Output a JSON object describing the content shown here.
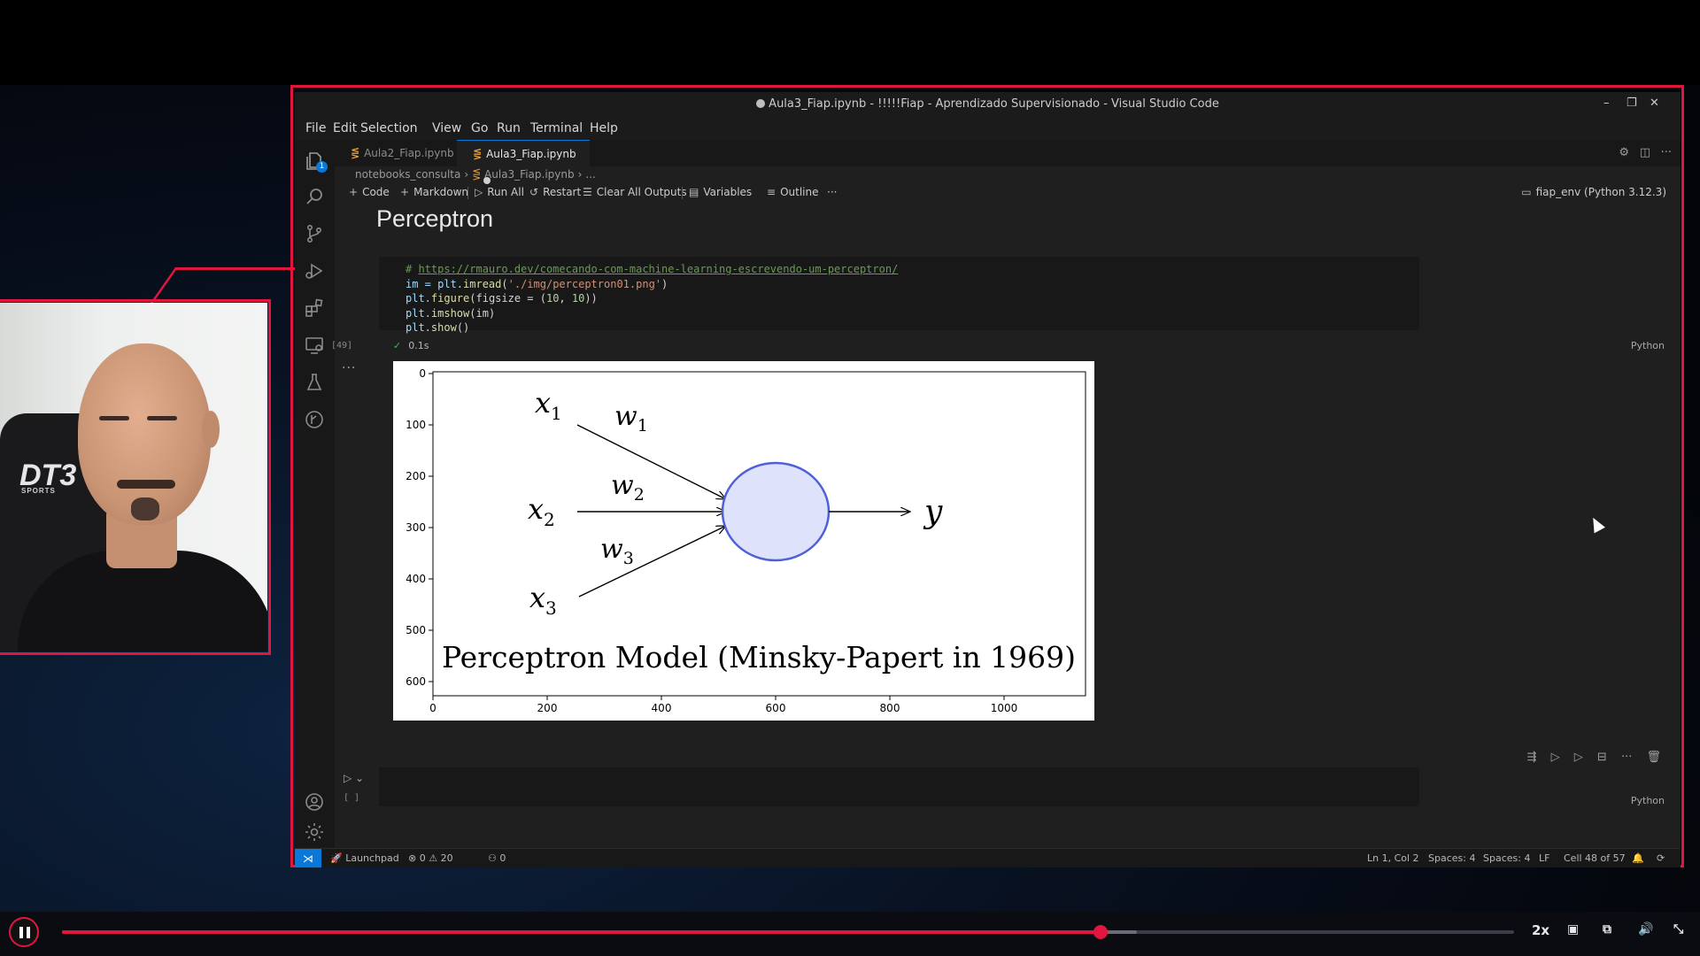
{
  "window": {
    "title": "Aula3_Fiap.ipynb - !!!!!Fiap - Aprendizado Supervisionado - Visual Studio Code"
  },
  "menu": [
    "File",
    "Edit",
    "Selection",
    "View",
    "Go",
    "Run",
    "Terminal",
    "Help"
  ],
  "tabs": [
    {
      "label": "Aula2_Fiap.ipynb",
      "active": false
    },
    {
      "label": "Aula3_Fiap.ipynb",
      "active": true,
      "unsaved": true
    }
  ],
  "breadcrumb": [
    "notebooks_consulta",
    "Aula3_Fiap.ipynb",
    "..."
  ],
  "toolbar": {
    "code": "Code",
    "markdown": "Markdown",
    "run_all": "Run All",
    "restart": "Restart",
    "clear_outputs": "Clear All Outputs",
    "variables": "Variables",
    "outline": "Outline",
    "more": "···",
    "kernel": "fiap_env (Python 3.12.3)"
  },
  "notebook": {
    "heading": "Perceptron",
    "code_lines": {
      "comment_prefix": "# ",
      "url": "https://rmauro.dev/comecando-com-machine-learning-escrevendo-um-perceptron/",
      "line2_a": "im = plt.",
      "line2_fn": "imread",
      "line2_b": "(",
      "line2_str": "'./img/perceptron01.png'",
      "line2_c": ")",
      "line3_a": "plt.",
      "line3_fn": "figure",
      "line3_b": "(figsize = (",
      "line3_n1": "10",
      "line3_c": ", ",
      "line3_n2": "10",
      "line3_d": "))",
      "line4_a": "plt.",
      "line4_fn": "imshow",
      "line4_b": "(im)",
      "line5_a": "plt.",
      "line5_fn": "show",
      "line5_b": "()"
    },
    "exec_count": "[49]",
    "exec_time": "0.1s",
    "language": "Python",
    "output_more": "...",
    "empty_count": "[ ]",
    "empty_language": "Python"
  },
  "plot": {
    "x_ticks": [
      "0",
      "200",
      "400",
      "600",
      "800",
      "1000"
    ],
    "y_ticks": [
      "0",
      "100",
      "200",
      "300",
      "400",
      "500",
      "600"
    ],
    "caption": "Perceptron Model (Minsky-Papert in 1969)",
    "inputs": [
      "x",
      "x",
      "x"
    ],
    "input_subs": [
      "1",
      "2",
      "3"
    ],
    "weights": [
      "w",
      "w",
      "w"
    ],
    "weight_subs": [
      "1",
      "2",
      "3"
    ],
    "output": "y"
  },
  "statusbar": {
    "launchpad": "Launchpad",
    "errors": "0",
    "warnings": "20",
    "ports": "0",
    "position": "Ln 1, Col 2",
    "spaces1": "Spaces: 4",
    "spaces2": "Spaces: 4",
    "eol": "LF",
    "cell": "Cell 48 of 57"
  },
  "webcam": {
    "chair_logo": "DT3",
    "chair_sub": "SPORTS"
  },
  "player": {
    "progress": 0.715,
    "buffered": 0.74,
    "speed": "2x"
  },
  "colors": {
    "accent": "#e0163f",
    "vscode_blue": "#0a78d6",
    "neuron_fill": "#dfe2fb",
    "neuron_stroke": "#5061d8"
  }
}
